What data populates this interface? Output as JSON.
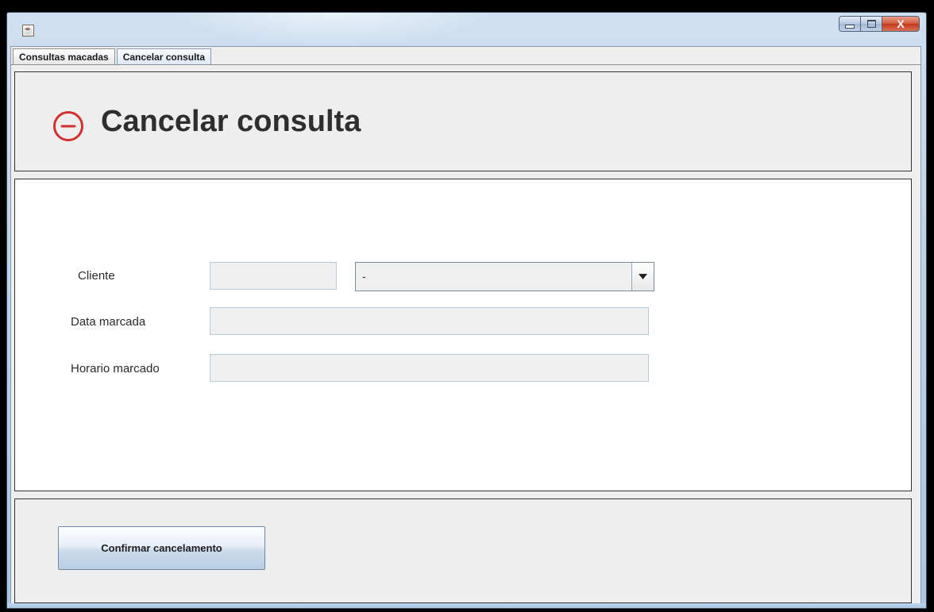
{
  "window": {
    "icon": "java-cup-icon",
    "buttons": {
      "minimize": "minimize-icon",
      "maximize": "maximize-icon",
      "close": "X"
    }
  },
  "tabs": [
    {
      "label": "Consultas macadas",
      "active": false
    },
    {
      "label": "Cancelar consulta",
      "active": true
    }
  ],
  "header": {
    "icon": "minus-circle-icon",
    "icon_color": "#d32f2f",
    "title": "Cancelar consulta"
  },
  "form": {
    "cliente_label": "Cliente",
    "cliente_id_value": "",
    "cliente_select_value": "-",
    "data_label": "Data marcada",
    "data_value": "",
    "horario_label": "Horario marcado",
    "horario_value": ""
  },
  "footer": {
    "confirm_label": "Confirmar cancelamento"
  }
}
